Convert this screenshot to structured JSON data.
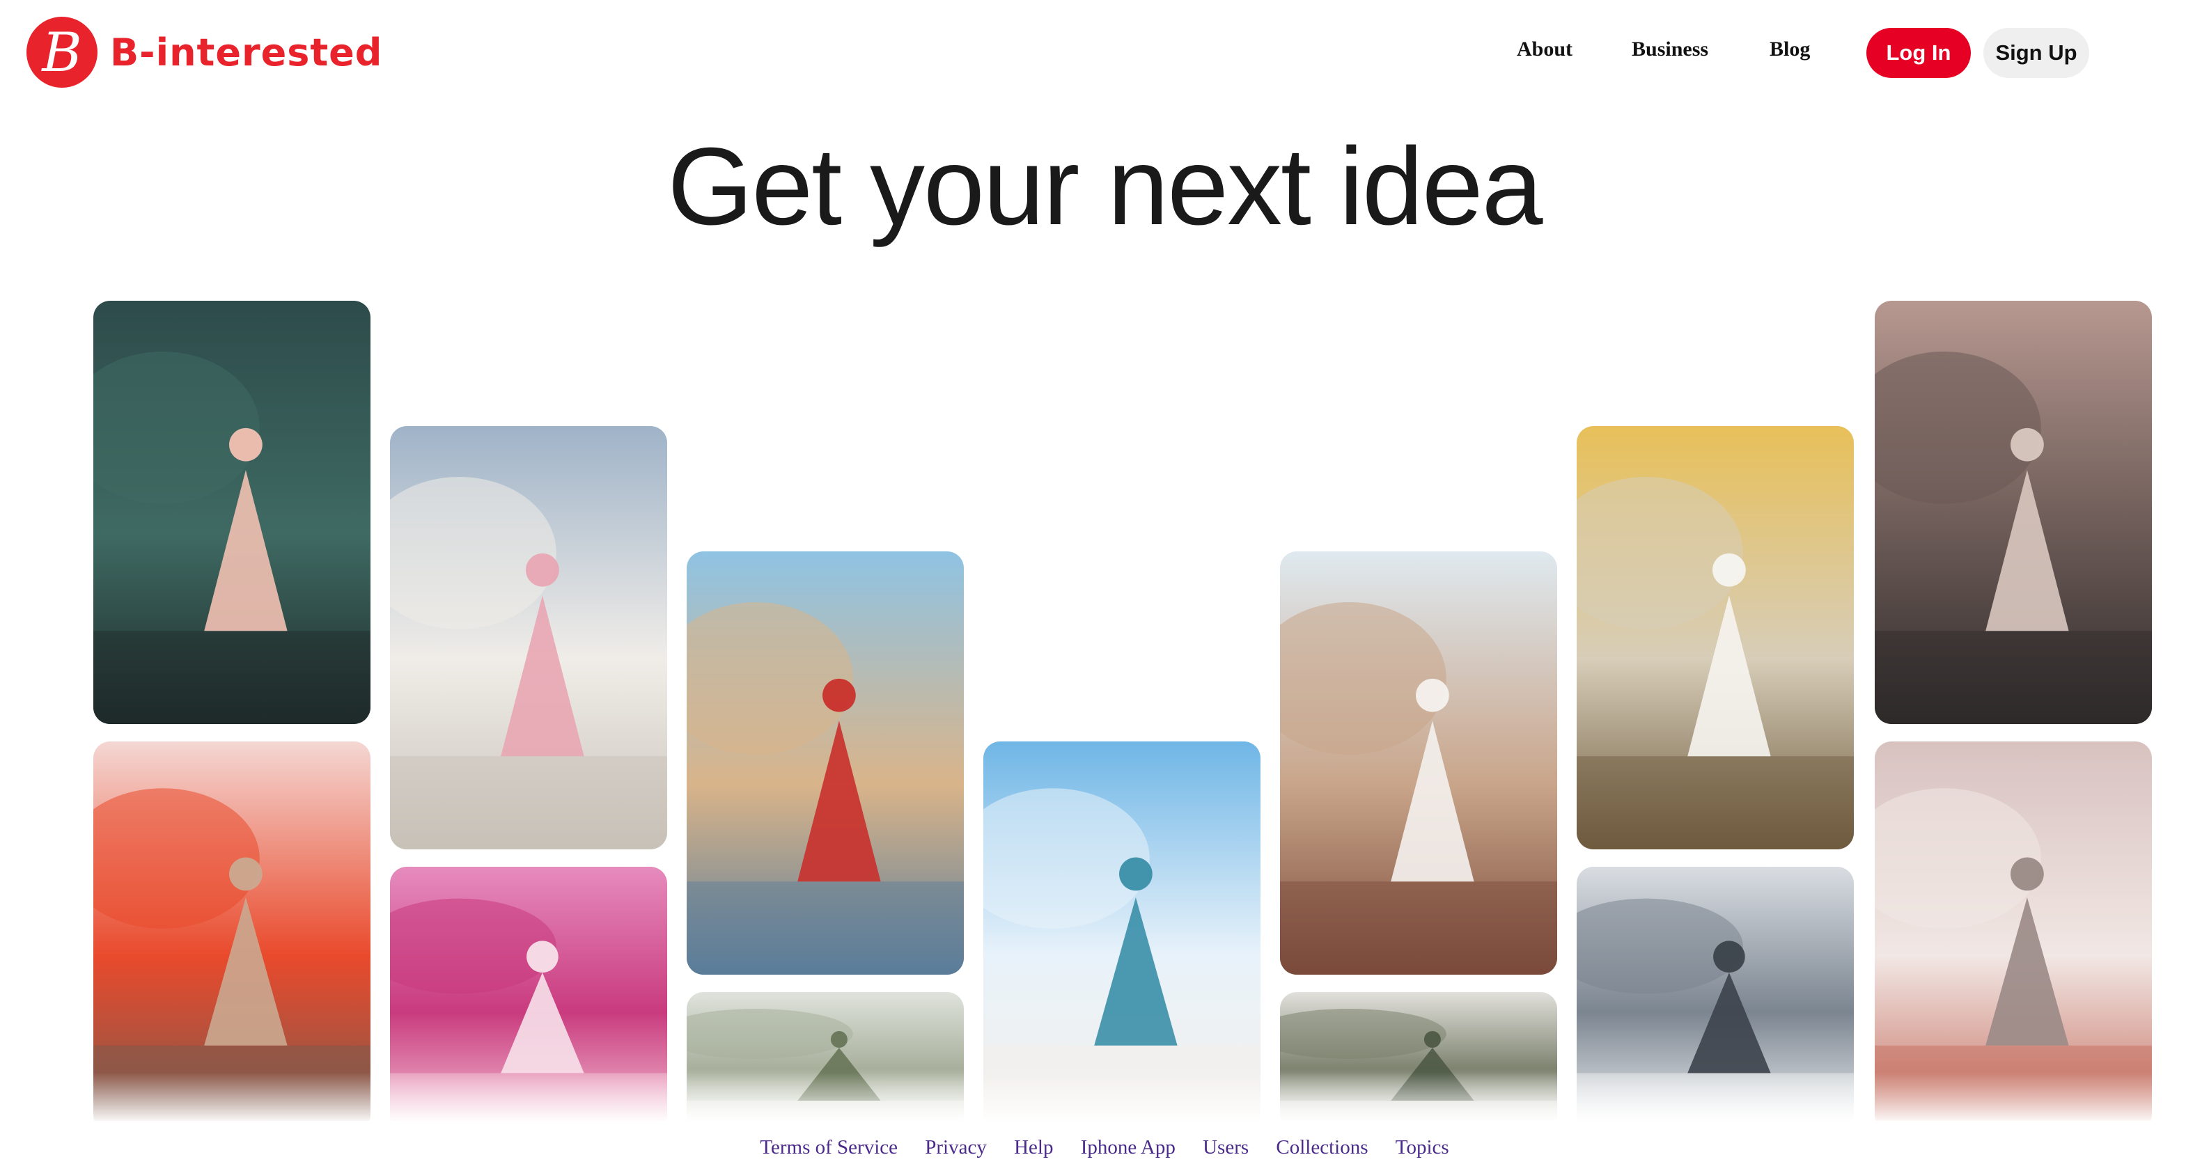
{
  "brand": {
    "name": "B-interested",
    "logo_letter": "B",
    "color": "#e9232b"
  },
  "nav": {
    "links": [
      "About",
      "Business",
      "Blog"
    ],
    "login_label": "Log In",
    "signup_label": "Sign Up"
  },
  "hero": {
    "headline": "Get your next idea"
  },
  "pins": [
    {
      "icon": "woman-pink-skirt-garden-photo",
      "palette": [
        "#2d4b4a",
        "#3f6a63",
        "#f2c1b2",
        "#1e2a2a"
      ]
    },
    {
      "icon": "balloons-terrace-red-dress-photo",
      "palette": [
        "#f4d7d3",
        "#e94a2c",
        "#caa990",
        "#7a5a4e"
      ]
    },
    {
      "icon": "santorini-pink-dress-photo",
      "palette": [
        "#9fb3c8",
        "#f0ede8",
        "#e8a6b3",
        "#c8c1b8"
      ]
    },
    {
      "icon": "tulip-field-hat-photo",
      "palette": [
        "#e68bbd",
        "#c93b7e",
        "#f7e1ea",
        "#f5c7d8"
      ]
    },
    {
      "icon": "eiffel-carousel-balloons-photo",
      "palette": [
        "#8fc3e3",
        "#d9b48a",
        "#c9302c",
        "#5a7d9a"
      ]
    },
    {
      "icon": "misty-pagoda-hills-photo",
      "palette": [
        "#dfe3dc",
        "#a8b09c",
        "#687558",
        "#f2f2ee"
      ]
    },
    {
      "icon": "swing-angel-wings-photo",
      "palette": [
        "#6fb6e6",
        "#e8f2fa",
        "#3a8fa8",
        "#f5f0ea"
      ]
    },
    {
      "icon": "snow-teddy-bear-photo",
      "palette": [
        "#dfe9ef",
        "#c9a58a",
        "#f4f1ee",
        "#7a4a3a"
      ]
    },
    {
      "icon": "misty-mountain-valley-photo",
      "palette": [
        "#e1e0db",
        "#7e8470",
        "#4f5a46",
        "#f3f2ee"
      ]
    },
    {
      "icon": "autumn-lake-white-dress-photo",
      "palette": [
        "#e8c05a",
        "#d7cdb8",
        "#f6f4f0",
        "#6e5a3e"
      ]
    },
    {
      "icon": "empire-state-city-window-photo",
      "palette": [
        "#d9dde2",
        "#7b8590",
        "#3c434b",
        "#f2f3f5"
      ]
    },
    {
      "icon": "street-fashion-skirt-photo",
      "palette": [
        "#b79890",
        "#6b5a56",
        "#d9c8c0",
        "#2e2a2a"
      ]
    },
    {
      "icon": "milan-cathedral-pigeons-photo",
      "palette": [
        "#d8c2c0",
        "#f1e7e4",
        "#9a8a86",
        "#c46a5a"
      ]
    }
  ],
  "footer": {
    "links": [
      "Terms of Service",
      "Privacy",
      "Help",
      "Iphone App",
      "Users",
      "Collections",
      "Topics"
    ],
    "color": "#4a2a8a"
  }
}
